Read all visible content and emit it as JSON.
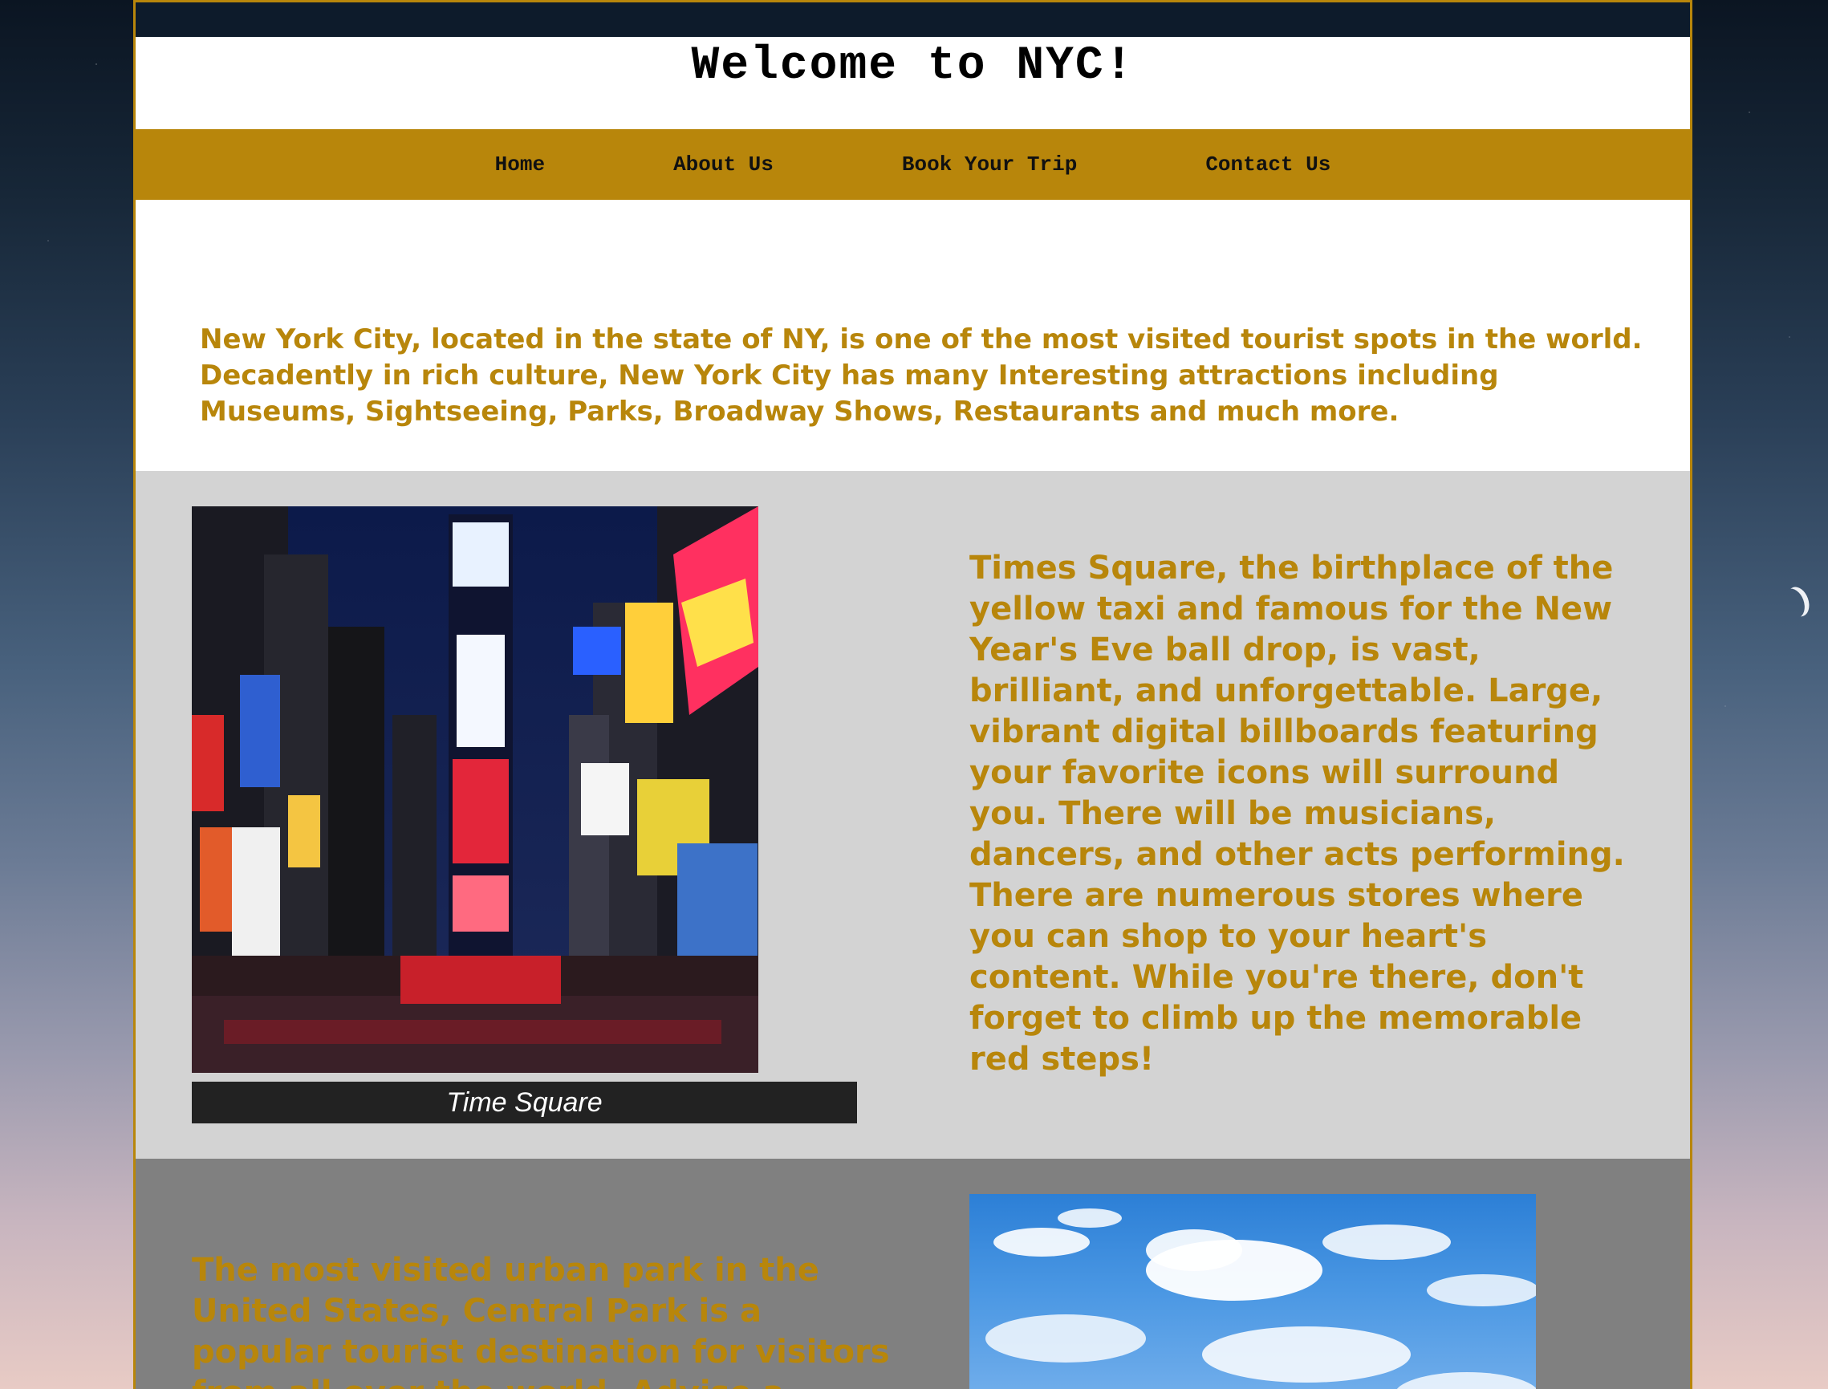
{
  "page": {
    "title": "Welcome to NYC!"
  },
  "nav": {
    "items": [
      {
        "label": "Home"
      },
      {
        "label": "About Us"
      },
      {
        "label": "Book Your Trip"
      },
      {
        "label": "Contact Us"
      }
    ]
  },
  "intro": {
    "text": "New York City, located in the state of NY, is one of the most visited tourist spots in the world. Decadently in rich culture, New York City has many Interesting attractions including Museums, Sightseeing, Parks, Broadway Shows, Restaurants and much more."
  },
  "times_square": {
    "caption": "Time Square",
    "description": "Times Square, the birthplace of the yellow taxi and famous for the New Year's Eve ball drop, is vast, brilliant, and unforgettable. Large, vibrant digital billboards featuring your favorite icons will surround you. There will be musicians, dancers, and other acts performing. There are numerous stores where you can shop to your heart's content. While you're there, don't forget to climb up the memorable red steps!"
  },
  "central_park": {
    "description": "The most visited urban park in the United States, Central Park is a popular tourist destination for visitors from all over the world. Advise a leisurely"
  },
  "colors": {
    "accent": "#b8860b",
    "section_light": "#d3d3d3",
    "section_dark": "#808080"
  }
}
